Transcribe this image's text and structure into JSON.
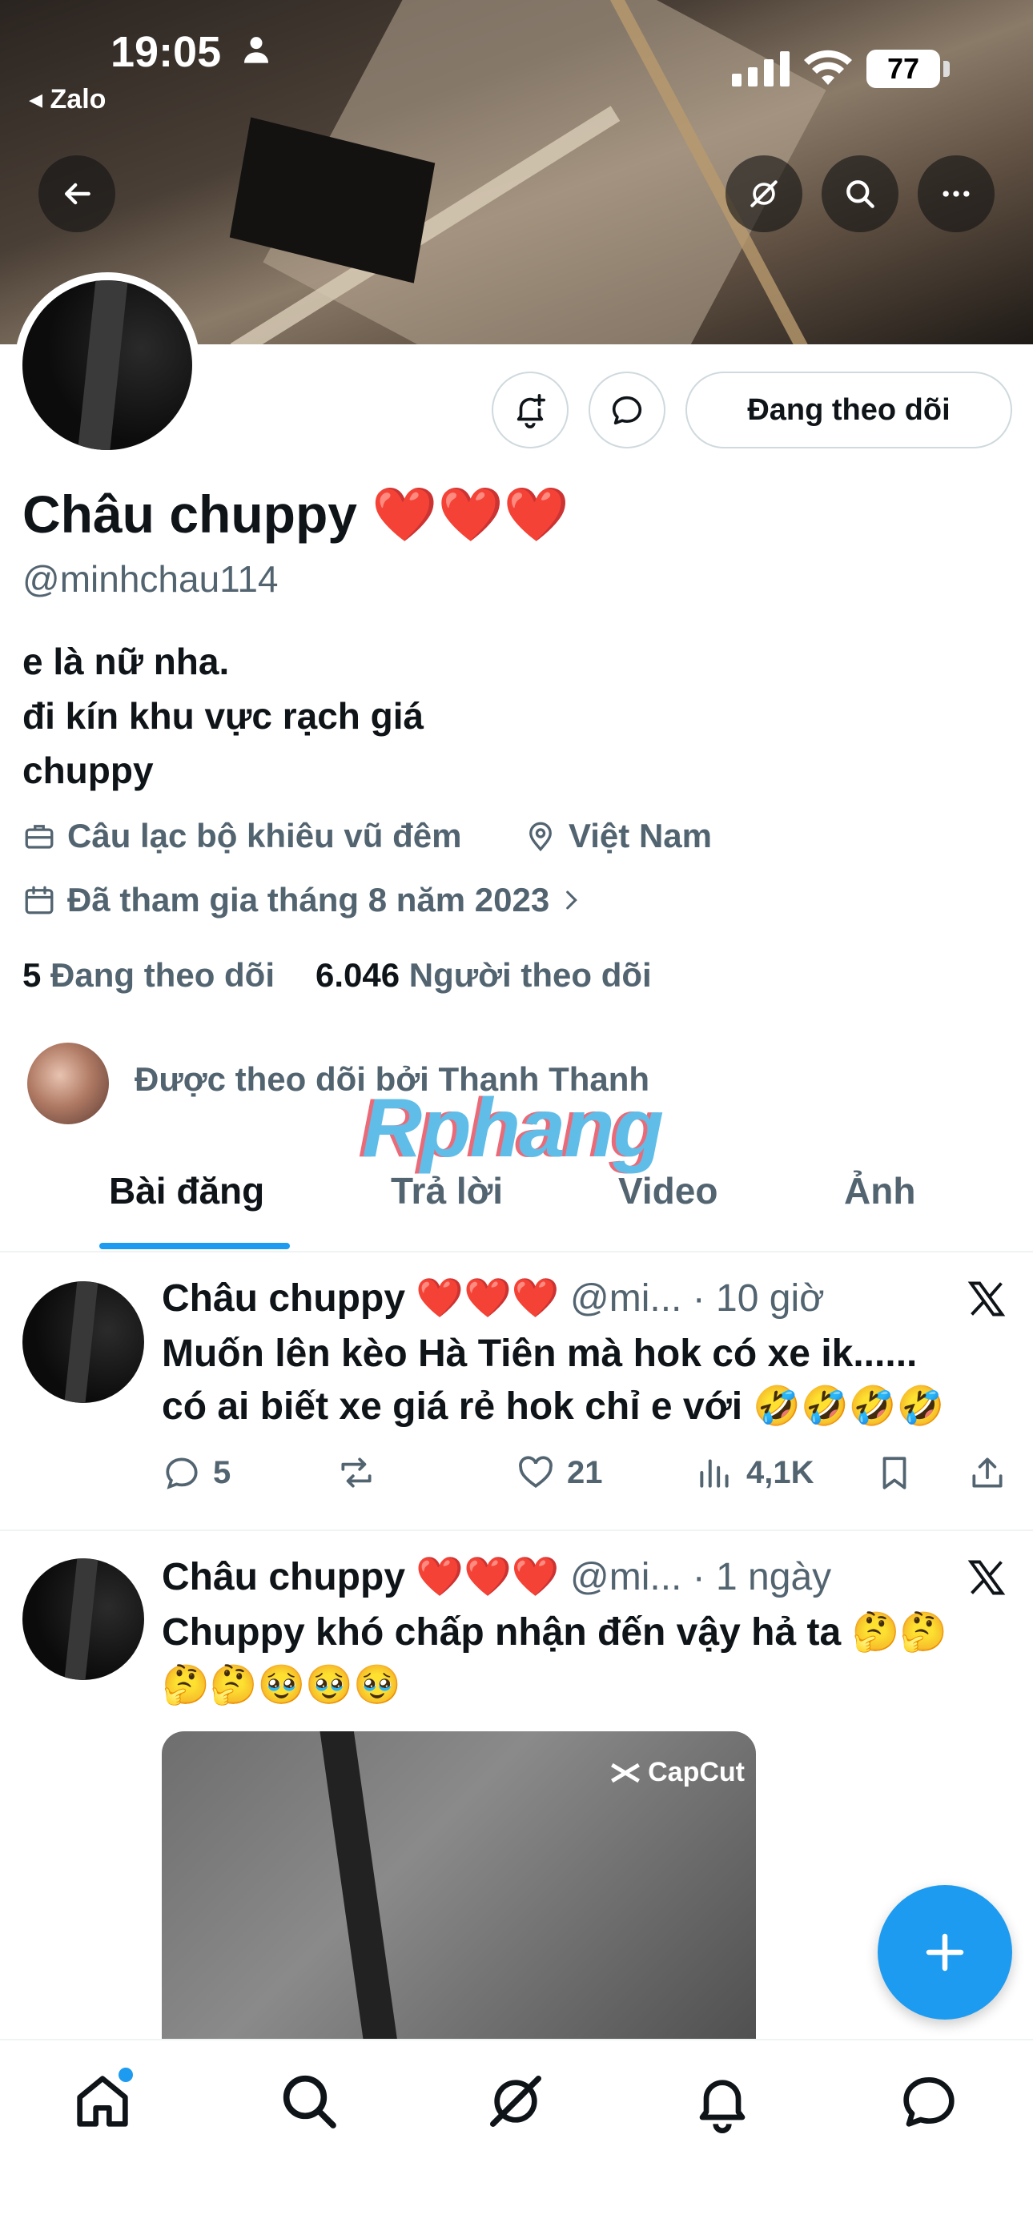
{
  "status_bar": {
    "time": "19:05",
    "back_app": "◂ Zalo",
    "battery": "77"
  },
  "profile": {
    "follow_button": "Đang theo dõi",
    "name": "Châu chuppy ❤️❤️❤️",
    "handle": "@minhchau114",
    "bio_lines": [
      "e là nữ nha.",
      "đi kín khu vực rạch giá",
      "chuppy"
    ],
    "category": "Câu lạc bộ khiêu vũ đêm",
    "location": "Việt Nam",
    "joined": "Đã tham gia tháng 8 năm 2023",
    "following_count": "5",
    "following_label": "Đang theo dõi",
    "followers_count": "6.046",
    "followers_label": "Người theo dõi",
    "followed_by": "Được theo dõi bởi Thanh Thanh"
  },
  "watermark": "Rphang",
  "tabs": [
    "Bài đăng",
    "Trả lời",
    "Video",
    "Ảnh"
  ],
  "posts": [
    {
      "name": "Châu chuppy ❤️❤️❤️",
      "meta": "@mi... · 10 giờ",
      "text_lines": [
        "Muốn lên kèo Hà Tiên mà hok có xe ik......",
        "có ai biết xe giá rẻ hok chỉ e với 🤣🤣🤣🤣"
      ],
      "replies": "5",
      "likes": "21",
      "views": "4,1K"
    },
    {
      "name": "Châu chuppy ❤️❤️❤️",
      "meta": "@mi... · 1 ngày",
      "text_lines": [
        "Chuppy khó chấp nhận đến vậy hả ta 🤔🤔",
        "🤔🤔🥹🥹🥹"
      ],
      "media_label": "CapCut"
    }
  ],
  "colors": {
    "accent": "#1d9bf0",
    "text": "#0f1419",
    "secondary": "#536471"
  }
}
